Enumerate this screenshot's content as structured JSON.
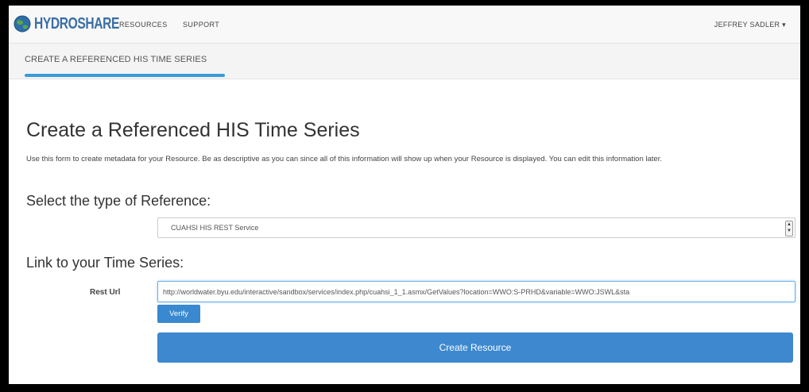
{
  "navbar": {
    "logo_text": "HYDROSHARE",
    "links": [
      "RESOURCES",
      "SUPPORT"
    ],
    "user": "JEFFREY SADLER",
    "user_caret": "▾"
  },
  "subnav": {
    "active_tab": "CREATE A REFERENCED HIS TIME SERIES"
  },
  "main": {
    "title": "Create a Referenced HIS Time Series",
    "intro": "Use this form to create metadata for your Resource. Be as descriptive as you can since all of this information will show up when your Resource is displayed. You can edit this information later.",
    "reference_heading": "Select the type of Reference:",
    "reference_type": {
      "selected": "CUAHSI HIS REST Service"
    },
    "link_heading": "Link to your Time Series:",
    "rest_url": {
      "label": "Rest Url",
      "value": "http://worldwater.byu.edu/interactive/sandbox/services/index.php/cuahsi_1_1.asmx/GetValues?location=WWO:S-PRHD&variable=WWO:JSWL&sta"
    },
    "verify_label": "Verify",
    "create_label": "Create Resource"
  },
  "colors": {
    "accent": "#3d88cf",
    "tab_underline": "#3a9bd8"
  },
  "icons": {
    "logo": "globe-logo-icon",
    "select_arrows": "select-arrows-icon",
    "user_caret": "chevron-down-icon"
  }
}
